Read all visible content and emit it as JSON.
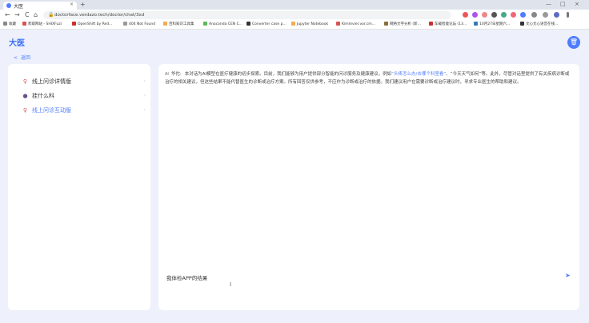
{
  "browser": {
    "tab_title": "大医",
    "tab_close": "×",
    "new_tab": "+",
    "url": "doctorface.verdazo.tech/doctor/chat/3xd",
    "nav": {
      "back": "←",
      "forward": "→",
      "reload": "C",
      "home": "⌂"
    },
    "window": {
      "minimize": "—",
      "maximize": "□",
      "close": "×"
    },
    "bookmarks": [
      {
        "label": "收藏",
        "color": "#888"
      },
      {
        "label": "爬取网站 - SHIXFuzi",
        "color": "#d9534f"
      },
      {
        "label": "OpenShift by Red...",
        "color": "#c9302c"
      },
      {
        "label": "404 Not Found",
        "color": "#999"
      },
      {
        "label": "百科知识工具集",
        "color": "#f0ad4e"
      },
      {
        "label": "Anaconda CEN C...",
        "color": "#5cb85c"
      },
      {
        "label": "Converter case p...",
        "color": "#333"
      },
      {
        "label": "Jupyter Notebook",
        "color": "#f0ad4e"
      },
      {
        "label": "Kimmvier.vor.cm...",
        "color": "#d9534f"
      },
      {
        "label": "网络文字分析 (新...",
        "color": "#8a6d3b"
      },
      {
        "label": "车载智能论坛 (13...",
        "color": "#c9302c"
      },
      {
        "label": "10月27日星期六...",
        "color": "#337ab7"
      },
      {
        "label": "文心文心语音在线...",
        "color": "#333"
      }
    ]
  },
  "app": {
    "title": "大医",
    "back_label": "返回",
    "back_arrow": "<",
    "trash_icon": "🗑"
  },
  "conversations": [
    {
      "label": "线上问诊详情版",
      "icon": "♀",
      "icon_color": "#d9534f",
      "active": false
    },
    {
      "label": "挂什么科",
      "icon": "●",
      "icon_color": "#6b4f8a",
      "active": false
    },
    {
      "label": "线上问诊互动版",
      "icon": "♀",
      "icon_color": "#d9534f",
      "active": true
    }
  ],
  "conversation_more": "›",
  "message": {
    "tag": "AI",
    "speaker": "华佗:",
    "text_a": "本对话为AI模型在医疗健康的初步探索。目前，我们能够为用户提供部分智能的问诊服务及健康建议，例如",
    "quote": "“头疼怎么办/去哪个科室看”",
    "text_b": "、“今天天气如何”等。此外，尽管对话里提供了有关疾病诊断或治疗的相关建议，但这些结果不能代替医生的诊断或治疗方案。所有回答仅供参考，不应作为诊断或治疗的依据。我们建议用户在需要诊断或治疗建议时，寻求专业医生的帮助和建议。"
  },
  "composer": {
    "value": "我体检APP的结果",
    "caret": "I",
    "send_icon": "➤"
  }
}
